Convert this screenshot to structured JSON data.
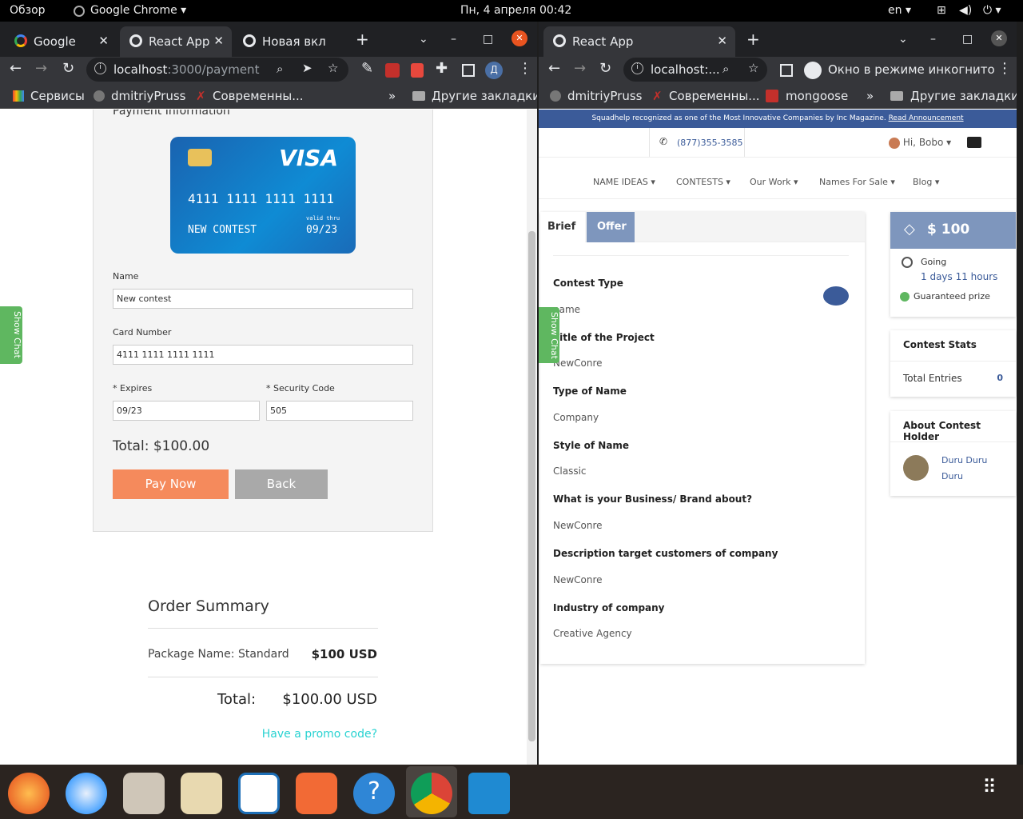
{
  "topbar": {
    "overview": "Обзор",
    "app": "Google Chrome",
    "clock": "Пн, 4 апреля  00:42",
    "lang": "en"
  },
  "left": {
    "tabs": [
      "Google",
      "React App",
      "Новая вкл"
    ],
    "url_host": "localhost",
    "url_path": ":3000/payment",
    "profile": "Д",
    "bookmarks": [
      "Сервисы",
      "dmitriyPruss",
      "Современны...",
      "Другие закладки"
    ],
    "form_title": "Payment Information",
    "card": {
      "brand": "VISA",
      "number": "4111 1111 1111 1111",
      "holder": "NEW CONTEST",
      "valid_label": "valid thru",
      "expiry": "09/23"
    },
    "name_label": "Name",
    "name_value": "New contest",
    "cardnum_label": "Card Number",
    "cardnum_value": "4111 1111 1111 1111",
    "expires_label": "* Expires",
    "expires_value": "09/23",
    "cvc_label": "* Security Code",
    "cvc_value": "505",
    "total": "Total: $100.00",
    "pay_btn": "Pay Now",
    "back_btn": "Back",
    "show_chat": "Show Chat",
    "summary": {
      "title": "Order Summary",
      "package": "Package Name: Standard",
      "package_price": "$100 USD",
      "total_label": "Total:",
      "total_value": "$100.00 USD",
      "promo": "Have a promo code?"
    }
  },
  "right": {
    "tab": "React App",
    "url": "localhost:...",
    "incognito": "Окно в режиме инкогнито",
    "bookmarks": [
      "dmitriyPruss",
      "Современны...",
      "mongoose",
      "Другие закладки"
    ],
    "banner": "Squadhelp recognized as one of the Most Innovative Companies by Inc Magazine.",
    "banner_link": "Read Announcement",
    "phone": "(877)355-3585",
    "greeting": "Hi, Bobo",
    "nav": [
      "NAME IDEAS",
      "CONTESTS",
      "Our Work",
      "Names For Sale",
      "Blog"
    ],
    "tabs": [
      "Brief",
      "Offer"
    ],
    "brief": [
      {
        "q": "Contest Type",
        "a": "name"
      },
      {
        "q": "Title of the Project",
        "a": "NewConre"
      },
      {
        "q": "Type of Name",
        "a": "Company"
      },
      {
        "q": "Style of Name",
        "a": "Classic"
      },
      {
        "q": "What is your Business/ Brand about?",
        "a": "NewConre"
      },
      {
        "q": "Description target customers of company",
        "a": "NewConre"
      },
      {
        "q": "Industry of company",
        "a": "Creative Agency"
      }
    ],
    "prize": "$ 100",
    "going": "Going",
    "remaining": "1 days 11 hours",
    "guaranteed": "Guaranteed prize",
    "stats_title": "Contest Stats",
    "entries_label": "Total Entries",
    "entries_value": "0",
    "holder_title": "About Contest Holder",
    "holder_name1": "Duru Duru",
    "holder_name2": "Duru",
    "show_chat": "Show Chat"
  },
  "colors": {
    "accent": "#3b5b99",
    "orange": "#f58a5c",
    "teal": "#28d2d1",
    "green": "#5fb760"
  }
}
